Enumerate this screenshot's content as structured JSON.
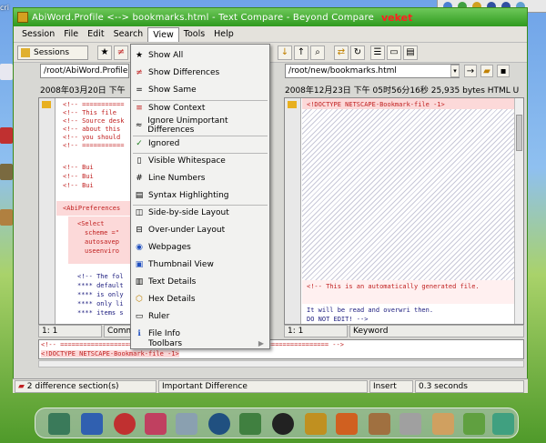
{
  "window": {
    "title": "AbiWord.Profile <--> bookmarks.html - Text Compare - Beyond Compare",
    "title_overlay": "veket"
  },
  "menu": [
    "Session",
    "File",
    "Edit",
    "Search",
    "View",
    "Tools",
    "Help"
  ],
  "toolbar": {
    "sessions_label": "Sessions"
  },
  "left": {
    "path": "/root/AbiWord.Profile",
    "info": "2008年03月20日 下午",
    "lines": [
      "<!-- ===========",
      "<!--  This file",
      "<!--  Source  desk",
      "<!--  about  this",
      "<!--  you  should",
      "<!-- ===========",
      "<!--          Bui",
      "<!--          Bui",
      "<!--          Bui",
      "<AbiPreferences",
      "<Select",
      "  scheme =\"",
      "  autosavep",
      "  useenviro",
      "<!--  The fol",
      "****  default",
      "****  is only",
      "****  only  li",
      "****  items  s"
    ],
    "status_pos": "1: 1",
    "status_mode": "Comm"
  },
  "right": {
    "path": "/root/new/bookmarks.html",
    "info": "2008年12月23日 下午 05时56分16秒   25,935 bytes  HTML U",
    "lines": [
      "<!DOCTYPE  NETSCAPE-Bookmark-file  -1>",
      "<!--  This  is  an  automatically  generated  file.",
      "      It  will  be  read  and  overwri  then.",
      "      DO  NOT  EDIT!  -->"
    ],
    "status_pos": "1: 1",
    "status_mode": "Keyword"
  },
  "compare": {
    "line1": "<!-- ====================================================================== -->",
    "line2": "<!DOCTYPE  NETSCAPE-Bookmark-file   -1>"
  },
  "view_menu": {
    "items": [
      {
        "label": "Show All",
        "icon": "star-icon"
      },
      {
        "label": "Show Differences",
        "icon": "diff-icon"
      },
      {
        "label": "Show Same",
        "icon": "same-icon"
      },
      {
        "label": "Show Context",
        "icon": "context-icon"
      },
      {
        "label": "Ignore Unimportant Differences",
        "icon": "ignore-icon"
      },
      {
        "label": "Ignored",
        "icon": "check-icon"
      },
      {
        "label": "Visible Whitespace",
        "icon": "whitespace-icon"
      },
      {
        "label": "Line Numbers",
        "icon": "line-numbers-icon"
      },
      {
        "label": "Syntax Highlighting",
        "icon": "syntax-icon"
      },
      {
        "label": "Side-by-side Layout",
        "icon": "side-by-side-icon"
      },
      {
        "label": "Over-under Layout",
        "icon": "over-under-icon"
      },
      {
        "label": "Webpages",
        "icon": "webpage-icon"
      },
      {
        "label": "Thumbnail View",
        "icon": "thumbnail-icon"
      },
      {
        "label": "Text Details",
        "icon": "text-details-icon"
      },
      {
        "label": "Hex Details",
        "icon": "hex-icon"
      },
      {
        "label": "Ruler",
        "icon": "ruler-icon"
      },
      {
        "label": "File Info",
        "icon": "info-icon"
      },
      {
        "label": "Toolbars",
        "icon": "toolbars-icon"
      }
    ]
  },
  "statusbar": {
    "diff_sections": "2 difference section(s)",
    "importance": "Important Difference",
    "mode": "Insert",
    "time": "0.3 seconds"
  },
  "colors": {
    "title_green": "#2f9a1e",
    "diff_pink": "#fcd9d9",
    "diff_red": "#c02020"
  }
}
